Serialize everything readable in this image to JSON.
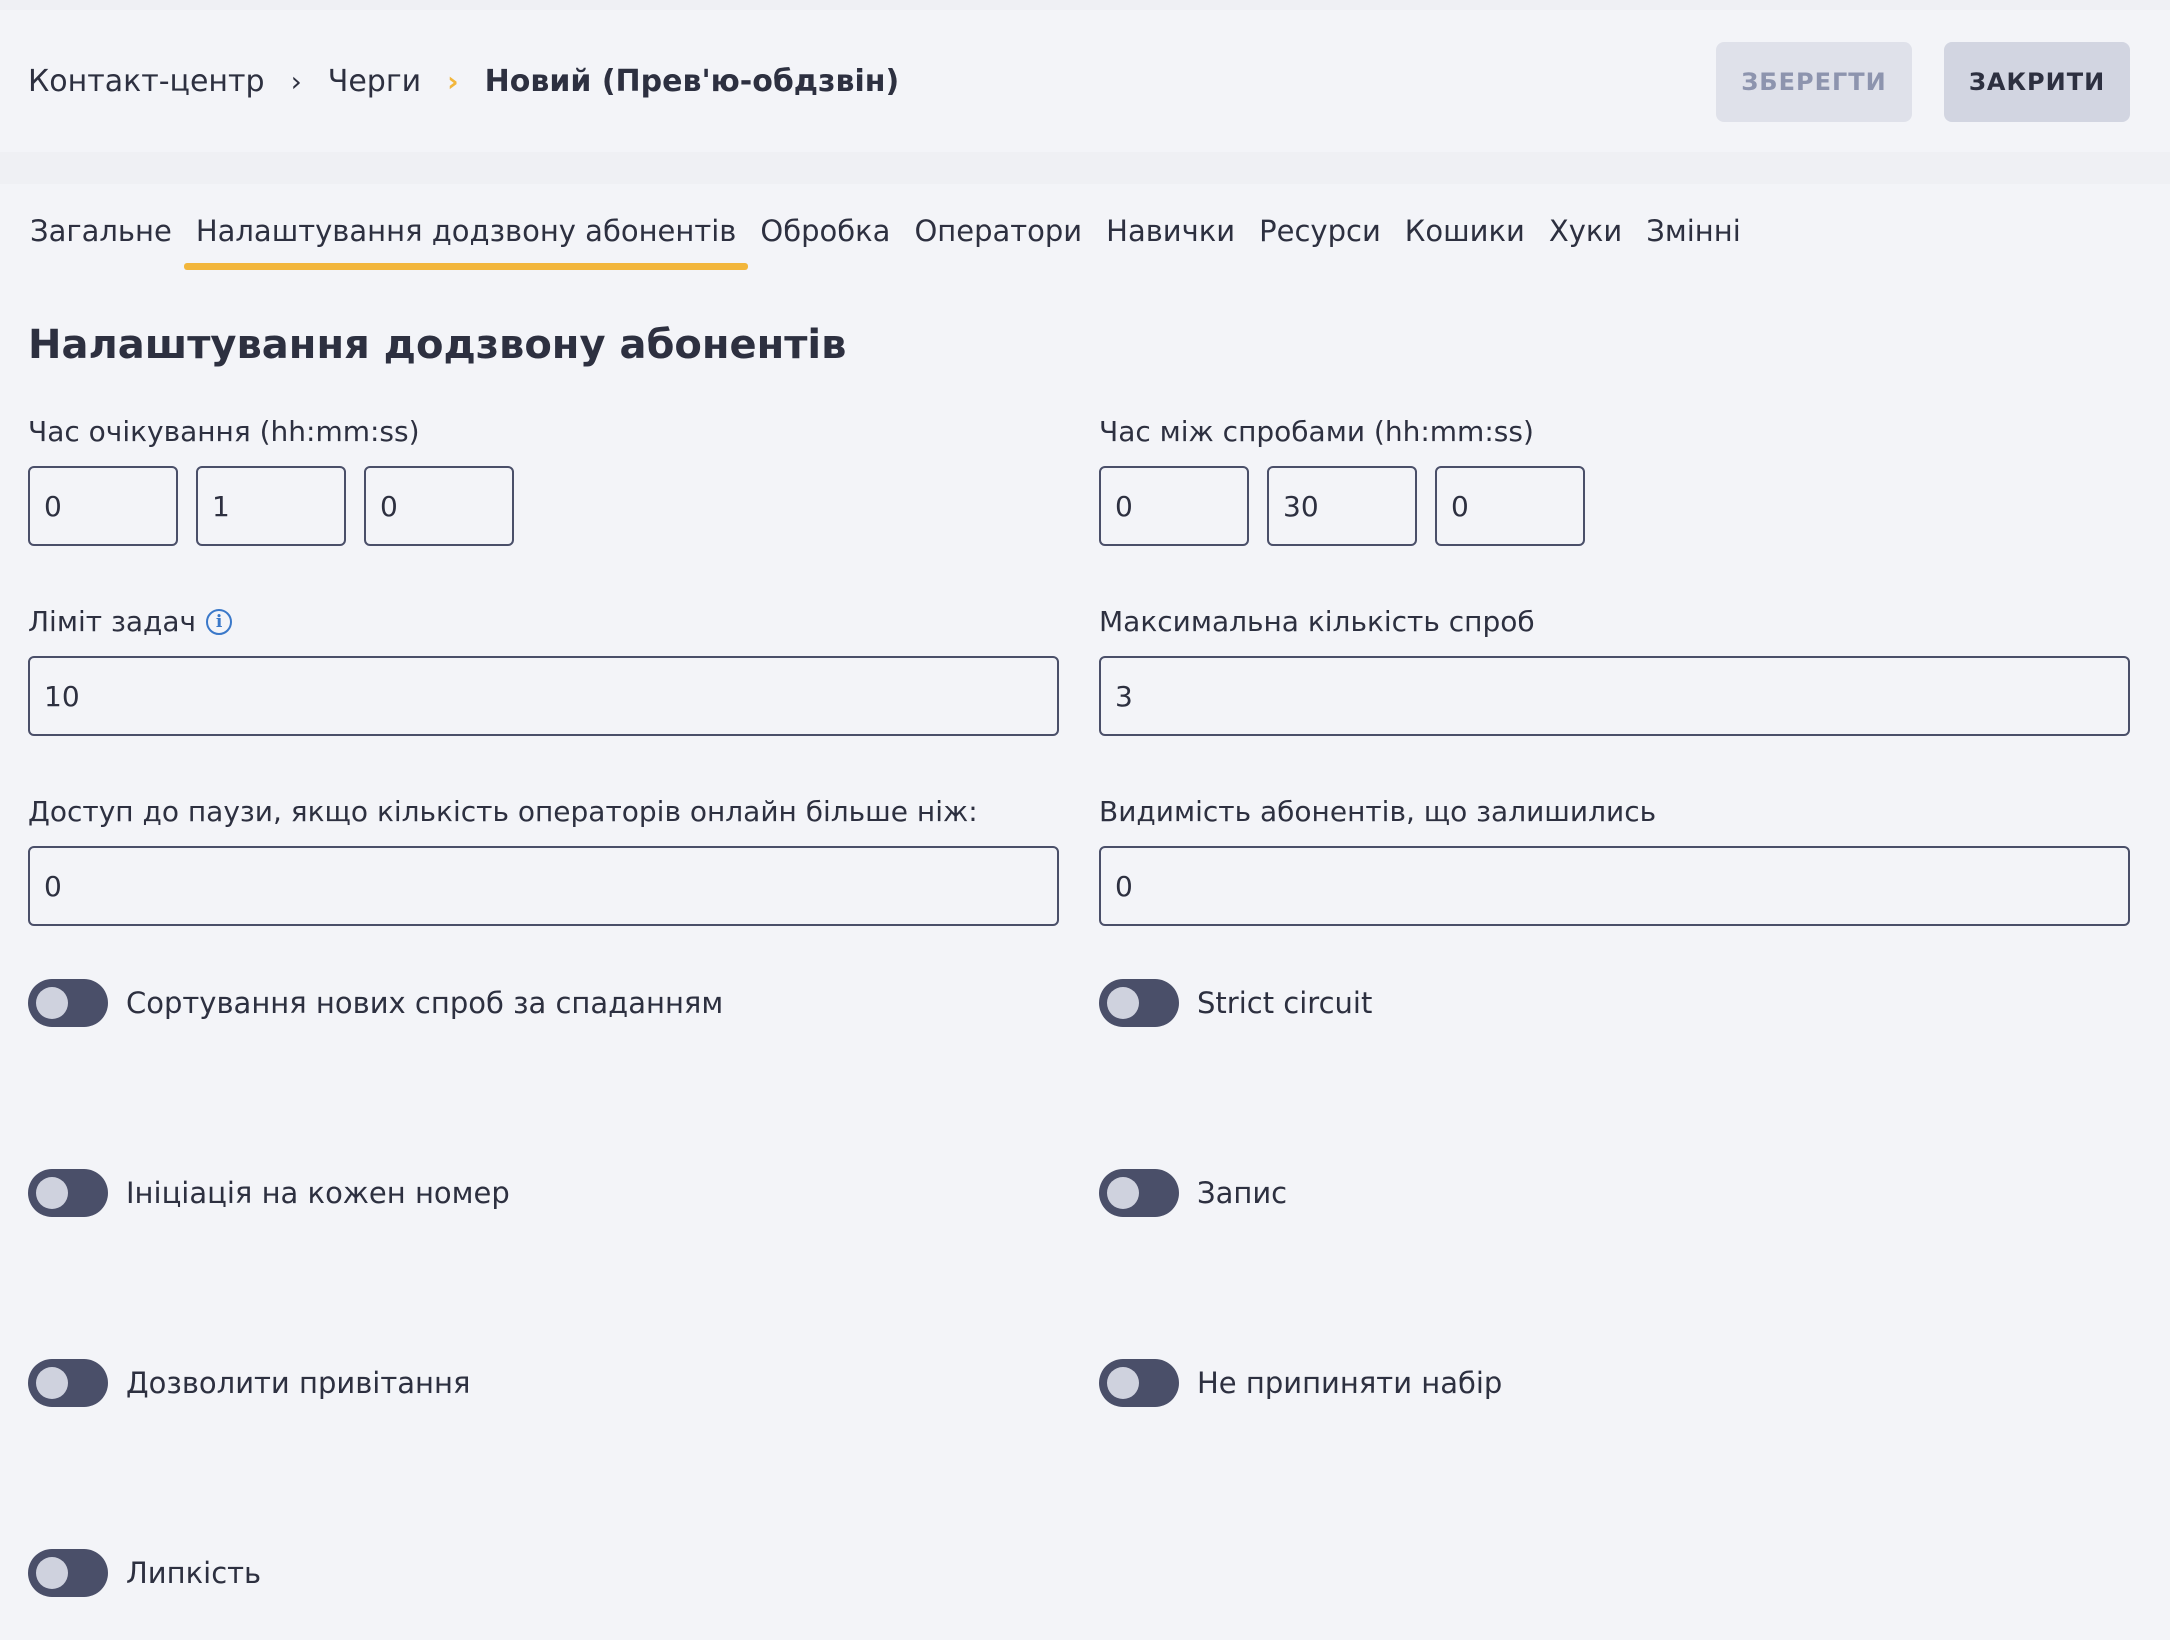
{
  "breadcrumb": {
    "items": [
      "Контакт-центр",
      "Черги",
      "Новий (Прев'ю-обдзвін)"
    ],
    "separator": "›"
  },
  "actions": {
    "save_label": "ЗБЕРЕГТИ",
    "close_label": "ЗАКРИТИ"
  },
  "tabs": [
    {
      "label": "Загальне"
    },
    {
      "label": "Налаштування додзвону абонентів",
      "active": true
    },
    {
      "label": "Обробка"
    },
    {
      "label": "Оператори"
    },
    {
      "label": "Навички"
    },
    {
      "label": "Ресурси"
    },
    {
      "label": "Кошики"
    },
    {
      "label": "Хуки"
    },
    {
      "label": "Змінні"
    }
  ],
  "section_title": "Налаштування додзвону абонентів",
  "fields": {
    "wait_time": {
      "label": "Час очікування (hh:mm:ss)",
      "hh": "0",
      "mm": "1",
      "ss": "0"
    },
    "retry_time": {
      "label": "Час між спробами (hh:mm:ss)",
      "hh": "0",
      "mm": "30",
      "ss": "0"
    },
    "task_limit": {
      "label": "Ліміт задач",
      "value": "10",
      "info_icon": "info-icon"
    },
    "max_attempts": {
      "label": "Максимальна кількість спроб",
      "value": "3"
    },
    "pause_access": {
      "label": "Доступ до паузи, якщо кількість операторів онлайн більше ніж:",
      "value": "0"
    },
    "remaining_visibility": {
      "label": "Видимість абонентів, що залишились",
      "value": "0"
    }
  },
  "toggles": {
    "sort_desc": {
      "label": "Сортування нових спроб за спаданням",
      "on": false
    },
    "strict_circuit": {
      "label": "Strict circuit",
      "on": false
    },
    "init_each_number": {
      "label": "Ініціація на кожен номер",
      "on": false
    },
    "record": {
      "label": "Запис",
      "on": false
    },
    "allow_greeting": {
      "label": "Дозволити привітання",
      "on": false
    },
    "dont_stop_dialing": {
      "label": "Не припиняти набір",
      "on": false
    },
    "stickiness": {
      "label": "Липкість",
      "on": false
    }
  },
  "colors": {
    "accent": "#f2b63c",
    "toggle_off": "#4a4f69",
    "text": "#2d3040",
    "info": "#3a78c9"
  }
}
